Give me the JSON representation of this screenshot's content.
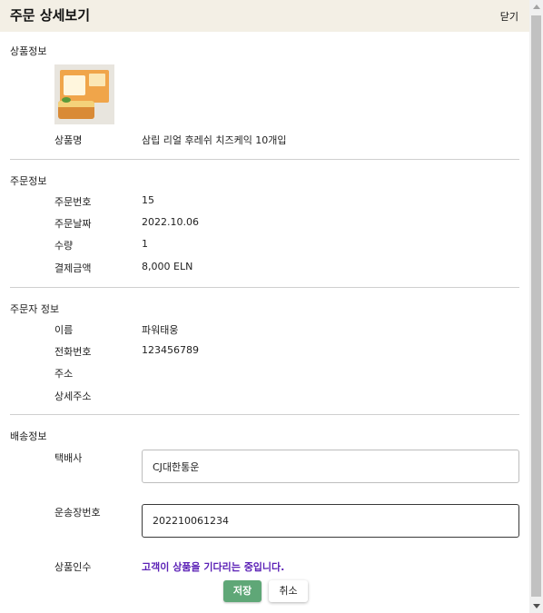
{
  "header": {
    "title": "주문 상세보기",
    "close_label": "닫기"
  },
  "product": {
    "section_title": "상품정보",
    "name_label": "상품명",
    "name_value": "삼립 리얼 후레쉬 치즈케익 10개입"
  },
  "order": {
    "section_title": "주문정보",
    "fields": [
      {
        "label": "주문번호",
        "value": "15"
      },
      {
        "label": "주문날짜",
        "value": "2022.10.06"
      },
      {
        "label": "수량",
        "value": "1"
      },
      {
        "label": "결제금액",
        "value": "8,000 ELN"
      }
    ]
  },
  "orderer": {
    "section_title": "주문자 정보",
    "fields": [
      {
        "label": "이름",
        "value": "파워태웅"
      },
      {
        "label": "전화번호",
        "value": "123456789"
      },
      {
        "label": "주소",
        "value": ""
      },
      {
        "label": "상세주소",
        "value": ""
      }
    ]
  },
  "shipping": {
    "section_title": "배송정보",
    "courier_label": "택배사",
    "courier_value": "CJ대한통운",
    "tracking_label": "운송장번호",
    "tracking_value": "202210061234",
    "receipt_label": "상품인수",
    "receipt_status": "고객이 상품을 기다리는 중입니다.",
    "status_color": "#5b21b6"
  },
  "actions": {
    "save_label": "저장",
    "cancel_label": "취소",
    "save_color": "#5fa777"
  }
}
